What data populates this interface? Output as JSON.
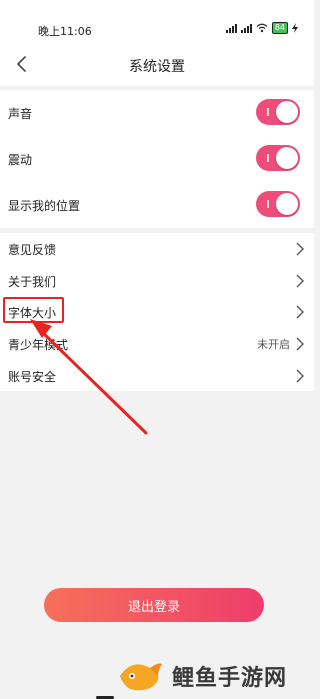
{
  "status_bar": {
    "time": "晚上11:06",
    "battery": "84"
  },
  "header": {
    "title": "系统设置"
  },
  "toggles": [
    {
      "label": "声音",
      "enabled": true
    },
    {
      "label": "震动",
      "enabled": true
    },
    {
      "label": "显示我的位置",
      "enabled": true
    }
  ],
  "menu": [
    {
      "label": "意见反馈",
      "value": ""
    },
    {
      "label": "关于我们",
      "value": ""
    },
    {
      "label": "字体大小",
      "value": ""
    },
    {
      "label": "青少年模式",
      "value": "未开启"
    },
    {
      "label": "账号安全",
      "value": ""
    }
  ],
  "logout_label": "退出登录",
  "watermark": {
    "text": "鲤鱼手游网"
  },
  "colors": {
    "accent": "#ee4d79",
    "annotation": "#e9231f"
  }
}
